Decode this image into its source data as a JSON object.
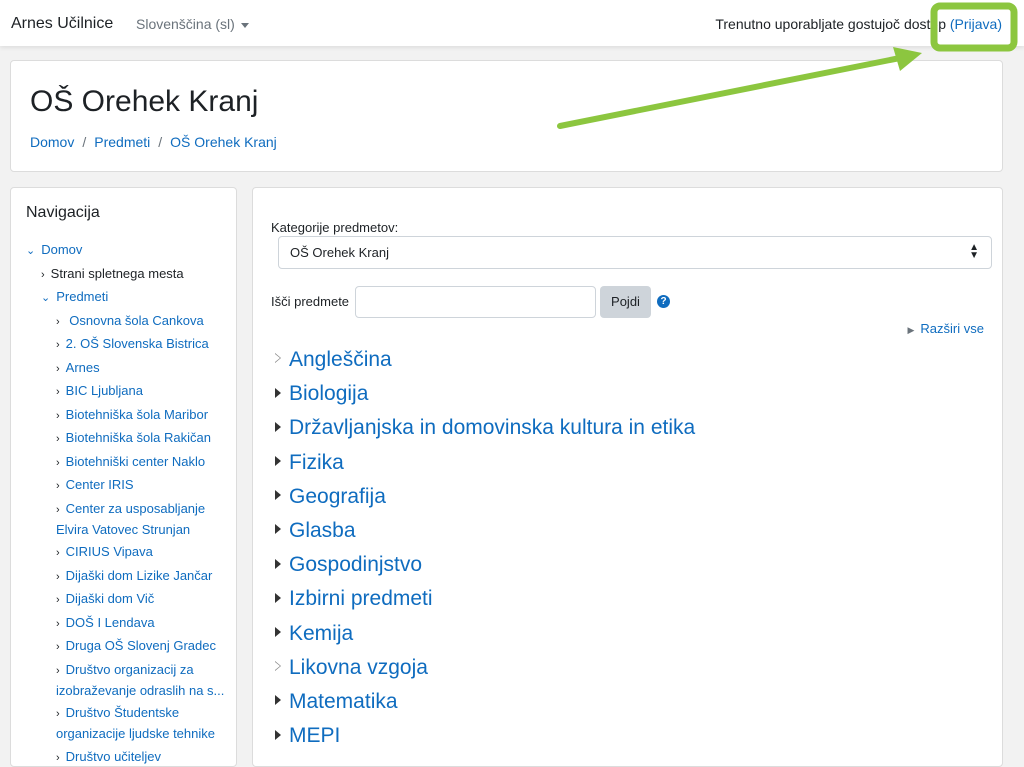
{
  "navbar": {
    "brand": "Arnes Učilnice",
    "language": "Slovenščina (sl)",
    "guest_text": "Trenutno uporabljate gostujoč dostop ",
    "login_link": "(Prijava)"
  },
  "header": {
    "title": "OŠ Orehek Kranj",
    "breadcrumb": [
      "Domov",
      "Predmeti",
      "OŠ Orehek Kranj"
    ]
  },
  "navigation": {
    "title": "Navigacija",
    "items": [
      {
        "label": "Domov"
      },
      {
        "label": "Strani spletnega mesta"
      },
      {
        "label": "Predmeti"
      },
      {
        "label": " Osnovna šola Cankova"
      },
      {
        "label": "2. OŠ Slovenska Bistrica"
      },
      {
        "label": "Arnes"
      },
      {
        "label": "BIC Ljubljana"
      },
      {
        "label": "Biotehniška šola Maribor"
      },
      {
        "label": "Biotehniška šola Rakičan"
      },
      {
        "label": "Biotehniški center Naklo"
      },
      {
        "label": "Center IRIS"
      },
      {
        "label": "Center za usposabljanje Elvira Vatovec Strunjan"
      },
      {
        "label": "CIRIUS Vipava"
      },
      {
        "label": "Dijaški dom Lizike Jančar"
      },
      {
        "label": "Dijaški dom Vič"
      },
      {
        "label": "DOŠ I Lendava"
      },
      {
        "label": "Druga OŠ Slovenj Gradec"
      },
      {
        "label": "Društvo organizacij za izobraževanje odraslih na s..."
      },
      {
        "label": "Društvo Študentske organizacije ljudske tehnike"
      },
      {
        "label": "Društvo učiteljev"
      }
    ]
  },
  "main": {
    "category_label": "Kategorije predmetov:",
    "category_selected": "OŠ Orehek Kranj",
    "search_label": "Išči predmete",
    "search_value": "",
    "search_button": "Pojdi",
    "expand_all": "Razširi vse",
    "categories": [
      {
        "label": "Angleščina",
        "hollow": true
      },
      {
        "label": "Biologija",
        "hollow": false
      },
      {
        "label": "Državljanjska in domovinska kultura in etika",
        "hollow": false
      },
      {
        "label": "Fizika",
        "hollow": false
      },
      {
        "label": "Geografija",
        "hollow": false
      },
      {
        "label": "Glasba",
        "hollow": false
      },
      {
        "label": "Gospodinjstvo",
        "hollow": false
      },
      {
        "label": "Izbirni predmeti",
        "hollow": false
      },
      {
        "label": "Kemija",
        "hollow": false
      },
      {
        "label": "Likovna vzgoja",
        "hollow": true
      },
      {
        "label": "Matematika",
        "hollow": false
      },
      {
        "label": "MEPI",
        "hollow": false
      }
    ]
  },
  "annotation": {
    "color": "#8cc63f"
  }
}
